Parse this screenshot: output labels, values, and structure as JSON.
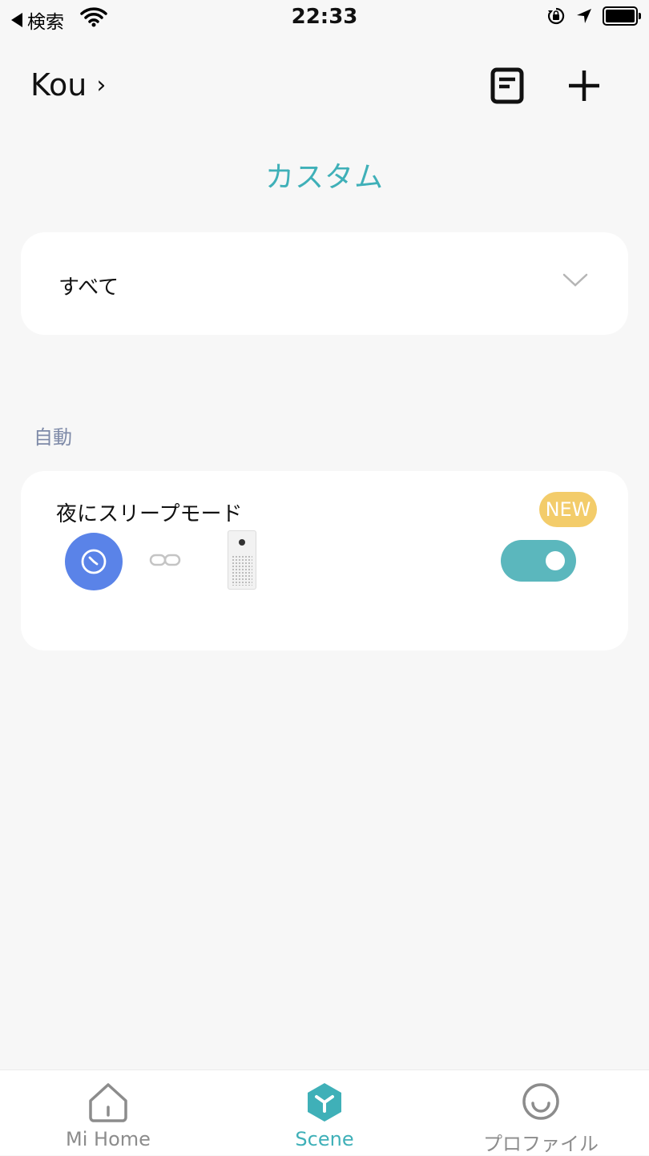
{
  "status_bar": {
    "back_label": "検索",
    "time": "22:33"
  },
  "header": {
    "home_name": "Kou",
    "home_chevron": "›"
  },
  "page_title": "カスタム",
  "filter": {
    "selected": "すべて"
  },
  "section": {
    "title": "自動"
  },
  "scene": {
    "name": "夜にスリープモード",
    "badge": "NEW",
    "enabled": true,
    "trigger_icon": "clock-icon",
    "device_icon": "air-purifier-icon"
  },
  "tabs": [
    {
      "label": "Mi Home",
      "icon": "home-icon",
      "active": false
    },
    {
      "label": "Scene",
      "icon": "scene-icon",
      "active": true
    },
    {
      "label": "プロファイル",
      "icon": "smiley-icon",
      "active": false
    }
  ],
  "colors": {
    "accent": "#3fb0b8",
    "toggle_on": "#5bb7bd",
    "badge": "#f3cc6a",
    "trigger_circle": "#5a83e8",
    "background": "#f7f7f7"
  }
}
